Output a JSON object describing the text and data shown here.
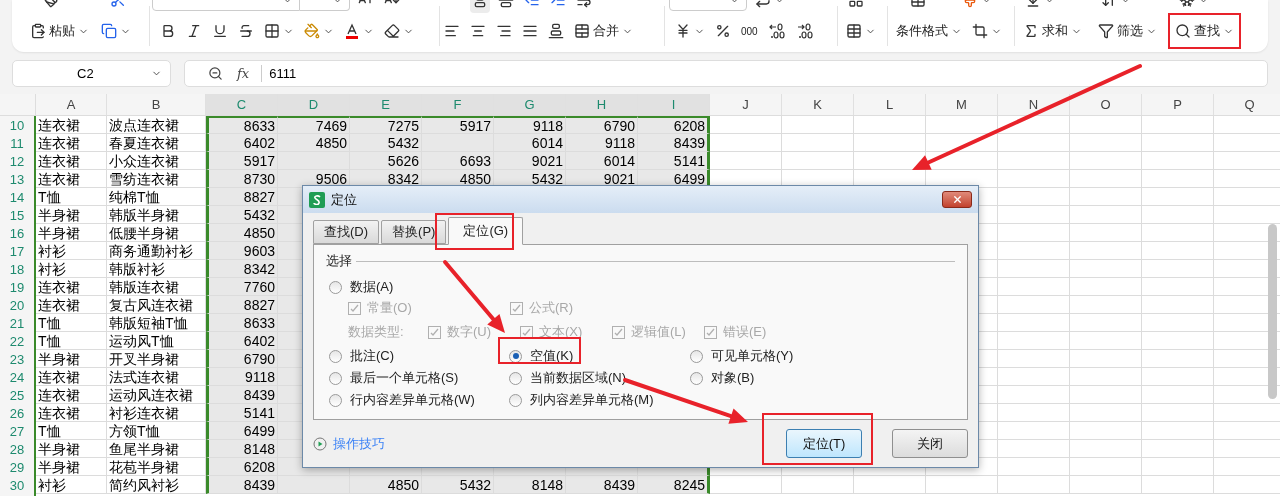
{
  "ribbon": {
    "bottom": {
      "paste": "粘贴",
      "merge": "合并",
      "thousands": "000",
      "cond_format": "条件格式",
      "sum": "求和",
      "filter": "筛选",
      "find": "查找"
    }
  },
  "formula_bar": {
    "name_box": "C2",
    "fx_label": "fx",
    "formula": "6111"
  },
  "sheet": {
    "columns": [
      {
        "label": "A",
        "selected": false
      },
      {
        "label": "B",
        "selected": false
      },
      {
        "label": "C",
        "selected": true
      },
      {
        "label": "D",
        "selected": true
      },
      {
        "label": "E",
        "selected": true
      },
      {
        "label": "F",
        "selected": true
      },
      {
        "label": "G",
        "selected": true
      },
      {
        "label": "H",
        "selected": true
      },
      {
        "label": "I",
        "selected": true
      },
      {
        "label": "J",
        "selected": false
      },
      {
        "label": "K",
        "selected": false
      },
      {
        "label": "L",
        "selected": false
      },
      {
        "label": "M",
        "selected": false
      },
      {
        "label": "N",
        "selected": false
      },
      {
        "label": "O",
        "selected": false
      },
      {
        "label": "P",
        "selected": false
      },
      {
        "label": "Q",
        "selected": false
      }
    ],
    "rows": [
      {
        "number": "10",
        "selected": true,
        "cells": [
          "连衣裙",
          "波点连衣裙",
          "8633",
          "7469",
          "7275",
          "5917",
          "9118",
          "6790",
          "6208"
        ]
      },
      {
        "number": "11",
        "selected": true,
        "cells": [
          "连衣裙",
          "春夏连衣裙",
          "6402",
          "4850",
          "5432",
          null,
          "6014",
          "9118",
          "8439"
        ]
      },
      {
        "number": "12",
        "selected": true,
        "cells": [
          "连衣裙",
          "小众连衣裙",
          "5917",
          null,
          "5626",
          "6693",
          "9021",
          "6014",
          "5141"
        ]
      },
      {
        "number": "13",
        "selected": true,
        "cells": [
          "连衣裙",
          "雪纺连衣裙",
          "8730",
          "9506",
          "8342",
          "4850",
          "5432",
          "9021",
          "6499"
        ]
      },
      {
        "number": "14",
        "selected": true,
        "cells": [
          "T恤",
          "纯棉T恤",
          "8827"
        ]
      },
      {
        "number": "15",
        "selected": true,
        "cells": [
          "半身裙",
          "韩版半身裙",
          "5432"
        ]
      },
      {
        "number": "16",
        "selected": true,
        "cells": [
          "半身裙",
          "低腰半身裙",
          "4850"
        ]
      },
      {
        "number": "17",
        "selected": true,
        "cells": [
          "衬衫",
          "商务通勤衬衫",
          "9603"
        ]
      },
      {
        "number": "18",
        "selected": true,
        "cells": [
          "衬衫",
          "韩版衬衫",
          "8342"
        ]
      },
      {
        "number": "19",
        "selected": true,
        "cells": [
          "连衣裙",
          "韩版连衣裙",
          "7760"
        ]
      },
      {
        "number": "20",
        "selected": true,
        "cells": [
          "连衣裙",
          "复古风连衣裙",
          "8827"
        ]
      },
      {
        "number": "21",
        "selected": true,
        "cells": [
          "T恤",
          "韩版短袖T恤",
          "8633"
        ]
      },
      {
        "number": "22",
        "selected": true,
        "cells": [
          "T恤",
          "运动风T恤",
          "6402"
        ]
      },
      {
        "number": "23",
        "selected": true,
        "cells": [
          "半身裙",
          "开叉半身裙",
          "6790"
        ]
      },
      {
        "number": "24",
        "selected": true,
        "cells": [
          "连衣裙",
          "法式连衣裙",
          "9118"
        ]
      },
      {
        "number": "25",
        "selected": true,
        "cells": [
          "连衣裙",
          "运动风连衣裙",
          "8439"
        ]
      },
      {
        "number": "26",
        "selected": true,
        "cells": [
          "连衣裙",
          "衬衫连衣裙",
          "5141"
        ]
      },
      {
        "number": "27",
        "selected": true,
        "cells": [
          "T恤",
          "方领T恤",
          "6499"
        ]
      },
      {
        "number": "28",
        "selected": true,
        "cells": [
          "半身裙",
          "鱼尾半身裙",
          "8148"
        ]
      },
      {
        "number": "29",
        "selected": true,
        "cells": [
          "半身裙",
          "花苞半身裙",
          "6208"
        ]
      },
      {
        "number": "30",
        "selected": true,
        "cells": [
          "衬衫",
          "简约风衬衫",
          "8439",
          null,
          "4850",
          "5432",
          "8148",
          "8439",
          "8245"
        ]
      }
    ]
  },
  "dialog": {
    "title": "定位",
    "tabs": [
      {
        "label": "查找(D)",
        "selected": false
      },
      {
        "label": "替换(P)",
        "selected": false
      },
      {
        "label": "定位(G)",
        "selected": true
      }
    ],
    "group_label": "选择",
    "data_option": {
      "label": "数据(A)",
      "selected": false
    },
    "data_checks": [
      {
        "label": "常量(O)",
        "checked": true,
        "disabled": true
      },
      {
        "label": "公式(R)",
        "checked": true,
        "disabled": true
      }
    ],
    "types_label": "数据类型:",
    "type_checks": [
      {
        "label": "数字(U)",
        "checked": true,
        "disabled": true
      },
      {
        "label": "文本(X)",
        "checked": true,
        "disabled": true
      },
      {
        "label": "逻辑值(L)",
        "checked": true,
        "disabled": true
      },
      {
        "label": "错误(E)",
        "checked": true,
        "disabled": true
      }
    ],
    "options": [
      {
        "label": "批注(C)",
        "selected": false
      },
      {
        "label": "空值(K)",
        "selected": true
      },
      {
        "label": "可见单元格(Y)",
        "selected": false
      },
      {
        "label": "最后一个单元格(S)",
        "selected": false
      },
      {
        "label": "当前数据区域(N)",
        "selected": false
      },
      {
        "label": "对象(B)",
        "selected": false
      },
      {
        "label": "行内容差异单元格(W)",
        "selected": false
      },
      {
        "label": "列内容差异单元格(M)",
        "selected": false
      }
    ],
    "tips_link": "操作技巧",
    "buttons": [
      {
        "label": "定位(T)",
        "kind": "primary"
      },
      {
        "label": "关闭",
        "kind": "secondary"
      }
    ]
  }
}
